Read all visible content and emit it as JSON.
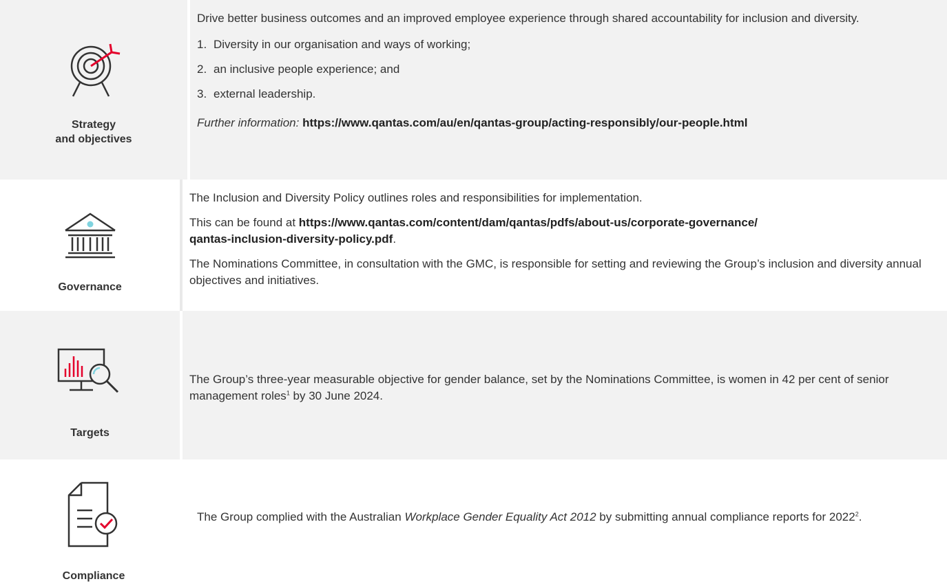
{
  "rows": {
    "strategy": {
      "label_line1": "Strategy",
      "label_line2": "and objectives",
      "icon": "target-icon",
      "intro": "Drive better business outcomes and an improved employee experience through shared accountability for inclusion and diversity.",
      "list": [
        {
          "num": "1.",
          "text": "Diversity in our organisation and ways of working;"
        },
        {
          "num": "2.",
          "text": "an inclusive people experience; and"
        },
        {
          "num": "3.",
          "text": "external leadership."
        }
      ],
      "further_label": "Further information:",
      "further_link": "https://www.qantas.com/au/en/qantas-group/acting-responsibly/our-people.html"
    },
    "governance": {
      "label": "Governance",
      "icon": "institution-icon",
      "p1": "The Inclusion and Diversity Policy outlines roles and responsibilities for implementation.",
      "p2_prefix": "This can be found at ",
      "p2_link_line1": "https://www.qantas.com/content/dam/qantas/pdfs/about-us/corporate-governance/",
      "p2_link_line2": "qantas-inclusion-diversity-policy.pdf",
      "p2_suffix": ".",
      "p3": "The Nominations Committee, in consultation with the GMC, is responsible for setting and reviewing the Group’s inclusion and diversity annual objectives and initiatives."
    },
    "targets": {
      "label": "Targets",
      "icon": "chart-magnifier-icon",
      "text_before": "The Group’s three-year measurable objective for gender balance, set by the Nominations Committee, is women in 42 per cent of senior management roles",
      "sup": "1",
      "text_after": " by 30 June 2024."
    },
    "compliance": {
      "label": "Compliance",
      "icon": "document-check-icon",
      "text_before": "The Group complied with the Australian ",
      "italic": "Workplace Gender Equality Act 2012",
      "text_middle": " by submitting annual compliance reports for 2022",
      "sup": "2",
      "text_after": "."
    }
  },
  "colors": {
    "accent_red": "#e4002b",
    "accent_cyan": "#7fd3df",
    "icon_stroke": "#333333",
    "row_grey": "#f2f2f2"
  }
}
